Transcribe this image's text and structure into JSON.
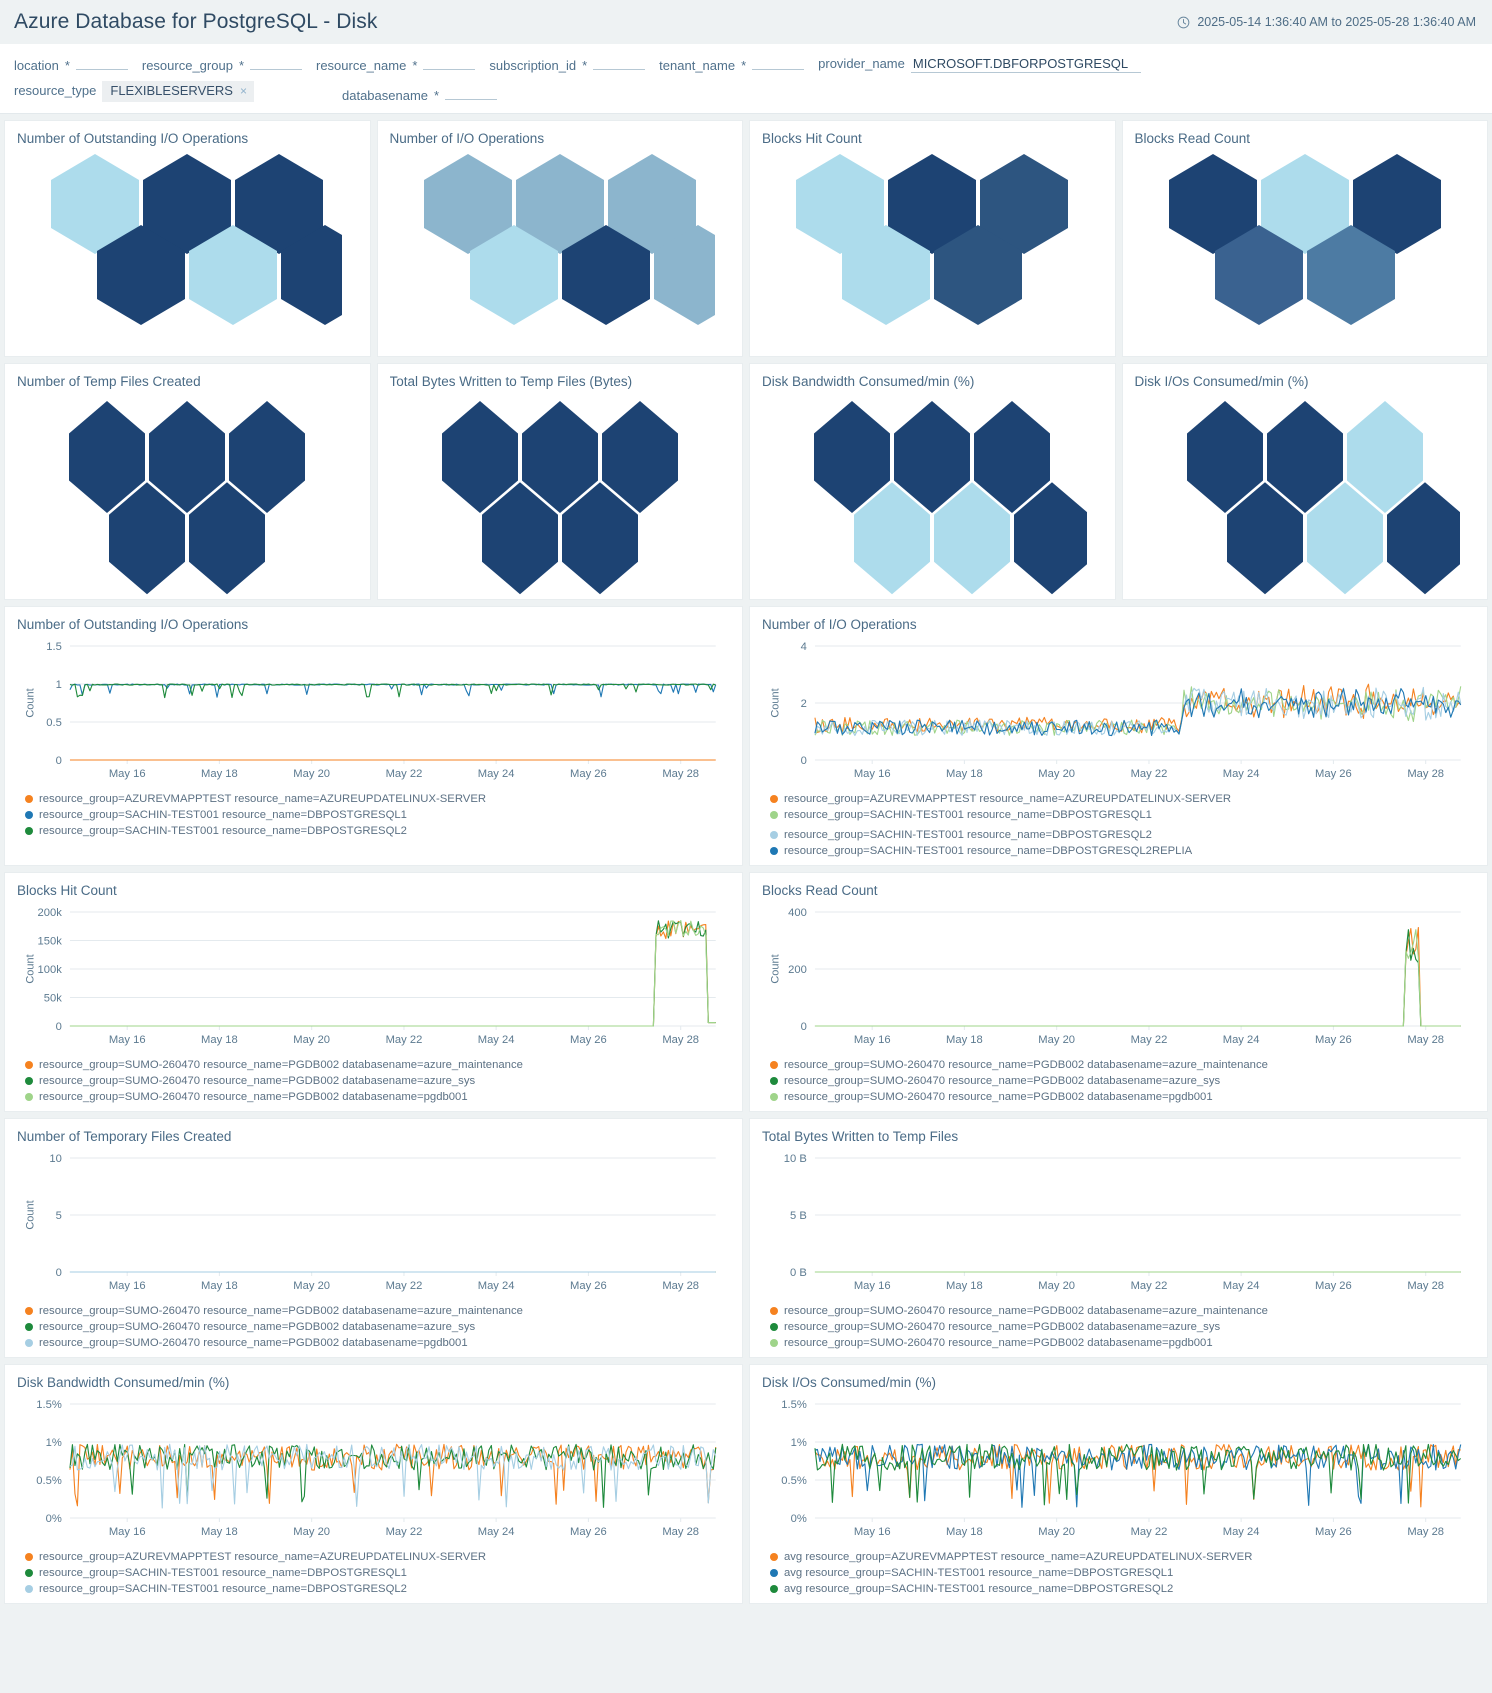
{
  "header": {
    "title": "Azure Database for PostgreSQL - Disk",
    "time_range": "2025-05-14 1:36:40 AM to 2025-05-28 1:36:40 AM",
    "clock_icon": "clock-icon"
  },
  "filters": [
    {
      "label": "location",
      "required": "*",
      "value": "",
      "placeholder": ""
    },
    {
      "label": "resource_group",
      "required": "*",
      "value": "",
      "placeholder": ""
    },
    {
      "label": "resource_name",
      "required": "*",
      "value": "",
      "placeholder": ""
    },
    {
      "label": "subscription_id",
      "required": "*",
      "value": "",
      "placeholder": ""
    },
    {
      "label": "tenant_name",
      "required": "*",
      "value": "",
      "placeholder": ""
    },
    {
      "label": "provider_name",
      "required": "",
      "value": "MICROSOFT.DBFORPOSTGRESQL",
      "placeholder": ""
    },
    {
      "label": "resource_type",
      "required": "",
      "chip": "FLEXIBLESERVERS",
      "chip_remove": "×"
    },
    {
      "label": "databasename",
      "required": "*",
      "value": "",
      "placeholder": ""
    }
  ],
  "palette": {
    "hex_darkest": "#1d4373",
    "hex_dark": "#1e4372",
    "hex_mid_dark": "#2d5580",
    "hex_mid": "#3a6290",
    "hex_mid2": "#446b94",
    "hex_steel": "#4d7ba3",
    "hex_steel2": "#5684ab",
    "hex_light_steel": "#8cb5cd",
    "hex_light": "#addcec",
    "hex_lighter": "#b3dcec",
    "series_orange": "#f58220",
    "series_blue": "#1f78b4",
    "series_green": "#1e8a3c",
    "series_lightgreen": "#9fd48a",
    "series_lightblue": "#a6cee3",
    "series_tan": "#e8b45a",
    "axis": "#5c7a90",
    "grid": "#e4eaee"
  },
  "hex_panels": [
    {
      "title": "Number of Outstanding I/O Operations",
      "shape": "hex-flat",
      "cells": [
        {
          "row": 0,
          "col": 0,
          "color": "#addcec"
        },
        {
          "row": 0,
          "col": 1,
          "color": "#1d4373"
        },
        {
          "row": 0,
          "col": 2,
          "color": "#1d4373"
        },
        {
          "row": 1,
          "col": 0,
          "color": "#1d4373"
        },
        {
          "row": 1,
          "col": 1,
          "color": "#addcec"
        },
        {
          "row": 1,
          "col": 2,
          "color": "#1d4373"
        }
      ]
    },
    {
      "title": "Number of I/O Operations",
      "shape": "hex-flat",
      "cells": [
        {
          "row": 0,
          "col": 0,
          "color": "#8cb5cd"
        },
        {
          "row": 0,
          "col": 1,
          "color": "#8cb5cd"
        },
        {
          "row": 0,
          "col": 2,
          "color": "#8cb5cd"
        },
        {
          "row": 1,
          "col": 0,
          "color": "#addcec"
        },
        {
          "row": 1,
          "col": 1,
          "color": "#1d4373"
        },
        {
          "row": 1,
          "col": 2,
          "color": "#8cb5cd"
        }
      ]
    },
    {
      "title": "Blocks Hit Count",
      "shape": "hex-flat",
      "cells": [
        {
          "row": 0,
          "col": 0,
          "color": "#addcec"
        },
        {
          "row": 0,
          "col": 1,
          "color": "#1d4373"
        },
        {
          "row": 0,
          "col": 2,
          "color": "#2d5580"
        },
        {
          "row": 1,
          "col": 0,
          "color": "#addcec"
        },
        {
          "row": 1,
          "col": 1,
          "color": "#2d5580"
        }
      ]
    },
    {
      "title": "Blocks Read Count",
      "shape": "hex-flat",
      "cells": [
        {
          "row": 0,
          "col": 0,
          "color": "#1d4373"
        },
        {
          "row": 0,
          "col": 1,
          "color": "#addcec"
        },
        {
          "row": 0,
          "col": 2,
          "color": "#1d4373"
        },
        {
          "row": 1,
          "col": 0,
          "color": "#3a6290"
        },
        {
          "row": 1,
          "col": 1,
          "color": "#4d7ba3"
        }
      ]
    },
    {
      "title": "Number of Temp Files Created",
      "shape": "hex-tall",
      "cells": [
        {
          "row": 0,
          "col": 0,
          "color": "#1d4373"
        },
        {
          "row": 0,
          "col": 1,
          "color": "#1d4373"
        },
        {
          "row": 0,
          "col": 2,
          "color": "#1d4373"
        },
        {
          "row": 1,
          "col": 0,
          "color": "#1d4373"
        },
        {
          "row": 1,
          "col": 1,
          "color": "#1d4373"
        }
      ]
    },
    {
      "title": "Total Bytes Written to Temp Files (Bytes)",
      "shape": "hex-tall",
      "cells": [
        {
          "row": 0,
          "col": 0,
          "color": "#1d4373"
        },
        {
          "row": 0,
          "col": 1,
          "color": "#1d4373"
        },
        {
          "row": 0,
          "col": 2,
          "color": "#1d4373"
        },
        {
          "row": 1,
          "col": 0,
          "color": "#1d4373"
        },
        {
          "row": 1,
          "col": 1,
          "color": "#1d4373"
        }
      ]
    },
    {
      "title": "Disk Bandwidth Consumed/min (%)",
      "shape": "hex-tall",
      "cells": [
        {
          "row": 0,
          "col": 0,
          "color": "#1d4373"
        },
        {
          "row": 0,
          "col": 1,
          "color": "#1d4373"
        },
        {
          "row": 0,
          "col": 2,
          "color": "#1d4373"
        },
        {
          "row": 1,
          "col": 0,
          "color": "#addcec"
        },
        {
          "row": 1,
          "col": 1,
          "color": "#addcec"
        },
        {
          "row": 1,
          "col": 2,
          "color": "#1d4373"
        }
      ]
    },
    {
      "title": "Disk I/Os Consumed/min (%)",
      "shape": "hex-tall",
      "cells": [
        {
          "row": 0,
          "col": 0,
          "color": "#1d4373"
        },
        {
          "row": 0,
          "col": 1,
          "color": "#1d4373"
        },
        {
          "row": 0,
          "col": 2,
          "color": "#addcec"
        },
        {
          "row": 1,
          "col": 0,
          "color": "#1d4373"
        },
        {
          "row": 1,
          "col": 1,
          "color": "#addcec"
        },
        {
          "row": 1,
          "col": 2,
          "color": "#1d4373"
        }
      ]
    }
  ],
  "chart_data": [
    {
      "id": "outstanding-io",
      "type": "line",
      "title": "Number of Outstanding I/O Operations",
      "ylabel": "Count",
      "xlabel": "",
      "ylim": [
        0,
        1.5
      ],
      "yticks": [
        "0",
        "0.5",
        "1",
        "1.5"
      ],
      "xticks": [
        "May 16",
        "May 18",
        "May 20",
        "May 22",
        "May 24",
        "May 26",
        "May 28"
      ],
      "grid": true,
      "legend_position": "bottom",
      "series": [
        {
          "name": "resource_group=AZUREVMAPPTEST resource_name=AZUREUPDATELINUX-SERVER",
          "color": "#f58220",
          "baseline": 0.0,
          "style": "flat-low"
        },
        {
          "name": "resource_group=SACHIN-TEST001 resource_name=DBPOSTGRESQL1",
          "color": "#1f78b4",
          "baseline": 1.0,
          "style": "noisy-flat"
        },
        {
          "name": "resource_group=SACHIN-TEST001 resource_name=DBPOSTGRESQL2",
          "color": "#1e8a3c",
          "baseline": 1.0,
          "style": "noisy-flat"
        }
      ]
    },
    {
      "id": "io-operations",
      "type": "line",
      "title": "Number of I/O Operations",
      "ylabel": "Count",
      "xlabel": "",
      "ylim": [
        0,
        4
      ],
      "yticks": [
        "0",
        "2",
        "4"
      ],
      "xticks": [
        "May 16",
        "May 18",
        "May 20",
        "May 22",
        "May 24",
        "May 26",
        "May 28"
      ],
      "grid": true,
      "legend_position": "bottom",
      "series": [
        {
          "name": "resource_group=AZUREVMAPPTEST resource_name=AZUREUPDATELINUX-SERVER",
          "color": "#f58220",
          "baseline": 1.2,
          "style": "noisy"
        },
        {
          "name": "resource_group=SACHIN-TEST001 resource_name=DBPOSTGRESQL1",
          "color": "#9fd48a",
          "baseline": 1.1,
          "style": "noisy"
        },
        {
          "name": "resource_group=SACHIN-TEST001 resource_name=DBPOSTGRESQL2",
          "color": "#a6cee3",
          "baseline": 1.1,
          "style": "noisy"
        },
        {
          "name": "resource_group=SACHIN-TEST001 resource_name=DBPOSTGRESQL2REPLIA",
          "color": "#1f78b4",
          "baseline": 1.1,
          "style": "noisy"
        }
      ]
    },
    {
      "id": "blocks-hit-count",
      "type": "line",
      "title": "Blocks Hit Count",
      "ylabel": "Count",
      "xlabel": "",
      "ylim": [
        0,
        200000
      ],
      "yticks": [
        "0",
        "50k",
        "100k",
        "150k",
        "200k"
      ],
      "xticks": [
        "May 16",
        "May 18",
        "May 20",
        "May 22",
        "May 24",
        "May 26",
        "May 28"
      ],
      "grid": true,
      "legend_position": "bottom",
      "series": [
        {
          "name": "resource_group=SUMO-260470 resource_name=PGDB002 databasename=azure_maintenance",
          "color": "#f58220",
          "baseline": 0,
          "style": "late-spike"
        },
        {
          "name": "resource_group=SUMO-260470 resource_name=PGDB002 databasename=azure_sys",
          "color": "#1e8a3c",
          "baseline": 0,
          "style": "late-spike"
        },
        {
          "name": "resource_group=SUMO-260470 resource_name=PGDB002 databasename=pgdb001",
          "color": "#9fd48a",
          "baseline": 0,
          "style": "late-spike"
        }
      ]
    },
    {
      "id": "blocks-read-count",
      "type": "line",
      "title": "Blocks Read Count",
      "ylabel": "Count",
      "xlabel": "",
      "ylim": [
        0,
        400
      ],
      "yticks": [
        "0",
        "200",
        "400"
      ],
      "xticks": [
        "May 16",
        "May 18",
        "May 20",
        "May 22",
        "May 24",
        "May 26",
        "May 28"
      ],
      "grid": true,
      "legend_position": "bottom",
      "series": [
        {
          "name": "resource_group=SUMO-260470 resource_name=PGDB002 databasename=azure_maintenance",
          "color": "#f58220",
          "baseline": 0,
          "style": "narrow-spike"
        },
        {
          "name": "resource_group=SUMO-260470 resource_name=PGDB002 databasename=azure_sys",
          "color": "#1e8a3c",
          "baseline": 0,
          "style": "narrow-spike"
        },
        {
          "name": "resource_group=SUMO-260470 resource_name=PGDB002 databasename=pgdb001",
          "color": "#9fd48a",
          "baseline": 0,
          "style": "narrow-spike"
        }
      ]
    },
    {
      "id": "temp-files-created",
      "type": "line",
      "title": "Number of Temporary Files Created",
      "ylabel": "Count",
      "xlabel": "",
      "ylim": [
        0,
        10
      ],
      "yticks": [
        "0",
        "5",
        "10"
      ],
      "xticks": [
        "May 16",
        "May 18",
        "May 20",
        "May 22",
        "May 24",
        "May 26",
        "May 28"
      ],
      "grid": true,
      "legend_position": "bottom",
      "series": [
        {
          "name": "resource_group=SUMO-260470 resource_name=PGDB002 databasename=azure_maintenance",
          "color": "#f58220",
          "baseline": 0,
          "style": "flat-zero-tail"
        },
        {
          "name": "resource_group=SUMO-260470 resource_name=PGDB002 databasename=azure_sys",
          "color": "#1e8a3c",
          "baseline": 0,
          "style": "flat-zero-tail"
        },
        {
          "name": "resource_group=SUMO-260470 resource_name=PGDB002 databasename=pgdb001",
          "color": "#a6cee3",
          "baseline": 0,
          "style": "flat-zero-tail"
        }
      ]
    },
    {
      "id": "temp-files-bytes",
      "type": "line",
      "title": "Total Bytes Written to Temp Files",
      "ylabel": "",
      "xlabel": "",
      "ylim": [
        0,
        10000000000
      ],
      "yticks": [
        "0 B",
        "5 B",
        "10 B"
      ],
      "xticks": [
        "May 16",
        "May 18",
        "May 20",
        "May 22",
        "May 24",
        "May 26",
        "May 28"
      ],
      "grid": true,
      "legend_position": "bottom",
      "series": [
        {
          "name": "resource_group=SUMO-260470 resource_name=PGDB002 databasename=azure_maintenance",
          "color": "#f58220",
          "baseline": 0,
          "style": "flat-zero-tail"
        },
        {
          "name": "resource_group=SUMO-260470 resource_name=PGDB002 databasename=azure_sys",
          "color": "#1e8a3c",
          "baseline": 0,
          "style": "flat-zero-tail"
        },
        {
          "name": "resource_group=SUMO-260470 resource_name=PGDB002 databasename=pgdb001",
          "color": "#9fd48a",
          "baseline": 0,
          "style": "flat-zero-tail"
        }
      ]
    },
    {
      "id": "disk-bandwidth",
      "type": "line",
      "title": "Disk Bandwidth Consumed/min (%)",
      "ylabel": "",
      "xlabel": "",
      "ylim": [
        0,
        1.5
      ],
      "yticks": [
        "0%",
        "0.5%",
        "1%",
        "1.5%"
      ],
      "xticks": [
        "May 16",
        "May 18",
        "May 20",
        "May 22",
        "May 24",
        "May 26",
        "May 28"
      ],
      "grid": true,
      "legend_position": "bottom",
      "series": [
        {
          "name": "resource_group=AZUREVMAPPTEST resource_name=AZUREUPDATELINUX-SERVER",
          "color": "#f58220",
          "baseline": 0.8,
          "style": "jitter"
        },
        {
          "name": "resource_group=SACHIN-TEST001 resource_name=DBPOSTGRESQL1",
          "color": "#1e8a3c",
          "baseline": 0.8,
          "style": "jitter"
        },
        {
          "name": "resource_group=SACHIN-TEST001 resource_name=DBPOSTGRESQL2",
          "color": "#a6cee3",
          "baseline": 0.8,
          "style": "jitter"
        }
      ]
    },
    {
      "id": "disk-ios",
      "type": "line",
      "title": "Disk I/Os Consumed/min (%)",
      "ylabel": "",
      "xlabel": "",
      "ylim": [
        0,
        1.5
      ],
      "yticks": [
        "0%",
        "0.5%",
        "1%",
        "1.5%"
      ],
      "xticks": [
        "May 16",
        "May 18",
        "May 20",
        "May 22",
        "May 24",
        "May 26",
        "May 28"
      ],
      "grid": true,
      "legend_position": "bottom",
      "series": [
        {
          "name": "avg resource_group=AZUREVMAPPTEST resource_name=AZUREUPDATELINUX-SERVER",
          "color": "#f58220",
          "baseline": 0.8,
          "style": "jitter"
        },
        {
          "name": "avg resource_group=SACHIN-TEST001 resource_name=DBPOSTGRESQL1",
          "color": "#1f78b4",
          "baseline": 0.8,
          "style": "jitter"
        },
        {
          "name": "avg resource_group=SACHIN-TEST001 resource_name=DBPOSTGRESQL2",
          "color": "#1e8a3c",
          "baseline": 0.8,
          "style": "jitter"
        }
      ]
    }
  ]
}
